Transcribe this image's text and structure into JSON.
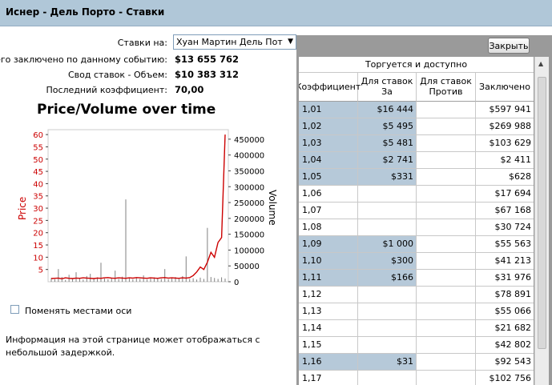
{
  "window": {
    "title": "Иснер - Дель Порто - Ставки"
  },
  "filters": {
    "bets_on_label": "Ставки на:",
    "bets_on_value": "Хуан Мартин Дель Потро",
    "total_label": "Всего заключено по данному событию:",
    "total_value": "$13 655 762",
    "summary_label": "Свод ставок - Объем:",
    "summary_value": "$10 383 312",
    "last_coef_label": "Последний коэффициент:",
    "last_coef_value": "70,00"
  },
  "chart_data": {
    "type": "line",
    "title": "Price/Volume over time",
    "ylabel": "Price",
    "y2label": "Volume",
    "ylim": [
      0,
      62
    ],
    "y2lim": [
      0,
      480000
    ],
    "yticks": [
      "60",
      "55",
      "50",
      "45",
      "40",
      "35",
      "30",
      "25",
      "20",
      "15",
      "10",
      "5"
    ],
    "y2ticks": [
      "450000",
      "400000",
      "350000",
      "300000",
      "250000",
      "200000",
      "150000",
      "100000",
      "50000",
      "0"
    ],
    "series": [
      {
        "name": "Price",
        "color": "#cc0000",
        "values": [
          1.3,
          1.4,
          1.5,
          1.2,
          1.6,
          1.4,
          1.3,
          1.5,
          1.4,
          1.6,
          1.5,
          1.4,
          1.3,
          1.5,
          1.4,
          1.6,
          1.7,
          1.5,
          1.4,
          1.6,
          1.5,
          1.4,
          1.6,
          1.5,
          1.7,
          1.6,
          1.5,
          1.4,
          1.6,
          1.5,
          1.4,
          1.6,
          1.7,
          1.5,
          1.6,
          1.5,
          1.4,
          1.6,
          1.5,
          1.7,
          2.5,
          4,
          6,
          5,
          8,
          12,
          10,
          16,
          18,
          60
        ]
      },
      {
        "name": "Volume",
        "color": "#808080",
        "values": [
          12000,
          8000,
          40000,
          15000,
          6000,
          22000,
          9000,
          30000,
          11000,
          7000,
          18000,
          25000,
          9000,
          14000,
          60000,
          10000,
          8000,
          12000,
          35000,
          9000,
          16000,
          260000,
          11000,
          8000,
          13000,
          9000,
          20000,
          7000,
          11000,
          14000,
          10000,
          9000,
          40000,
          8000,
          12000,
          15000,
          9000,
          18000,
          80000,
          9000,
          11000,
          7000,
          13000,
          9000,
          170000,
          15000,
          12000,
          9000,
          14000,
          10000
        ]
      }
    ]
  },
  "options": {
    "swap_axes_label": "Поменять местами оси",
    "swap_axes_checked": false
  },
  "info_text": "Информация на этой странице может отображаться с небольшой задержкой.",
  "panel": {
    "close_label": "Закрыть",
    "group_header": "Торгуется и доступно",
    "columns": [
      "Коэффициент",
      "Для ставок За",
      "Для ставок Против",
      "Заключено"
    ],
    "rows": [
      {
        "coef": "1,01",
        "for": "$16 444",
        "against": "",
        "done": "$597 941",
        "hl": true
      },
      {
        "coef": "1,02",
        "for": "$5 495",
        "against": "",
        "done": "$269 988",
        "hl": true
      },
      {
        "coef": "1,03",
        "for": "$5 481",
        "against": "",
        "done": "$103 629",
        "hl": true
      },
      {
        "coef": "1,04",
        "for": "$2 741",
        "against": "",
        "done": "$2 411",
        "hl": true
      },
      {
        "coef": "1,05",
        "for": "$331",
        "against": "",
        "done": "$628",
        "hl": true
      },
      {
        "coef": "1,06",
        "for": "",
        "against": "",
        "done": "$17 694",
        "hl": false
      },
      {
        "coef": "1,07",
        "for": "",
        "against": "",
        "done": "$67 168",
        "hl": false
      },
      {
        "coef": "1,08",
        "for": "",
        "against": "",
        "done": "$30 724",
        "hl": false
      },
      {
        "coef": "1,09",
        "for": "$1 000",
        "against": "",
        "done": "$55 563",
        "hl": true
      },
      {
        "coef": "1,10",
        "for": "$300",
        "against": "",
        "done": "$41 213",
        "hl": true
      },
      {
        "coef": "1,11",
        "for": "$166",
        "against": "",
        "done": "$31 976",
        "hl": true
      },
      {
        "coef": "1,12",
        "for": "",
        "against": "",
        "done": "$78 891",
        "hl": false
      },
      {
        "coef": "1,13",
        "for": "",
        "against": "",
        "done": "$55 066",
        "hl": false
      },
      {
        "coef": "1,14",
        "for": "",
        "against": "",
        "done": "$21 682",
        "hl": false
      },
      {
        "coef": "1,15",
        "for": "",
        "against": "",
        "done": "$42 802",
        "hl": false
      },
      {
        "coef": "1,16",
        "for": "$31",
        "against": "",
        "done": "$92 543",
        "hl": true
      },
      {
        "coef": "1,17",
        "for": "",
        "against": "",
        "done": "$102 756",
        "hl": false
      }
    ]
  }
}
